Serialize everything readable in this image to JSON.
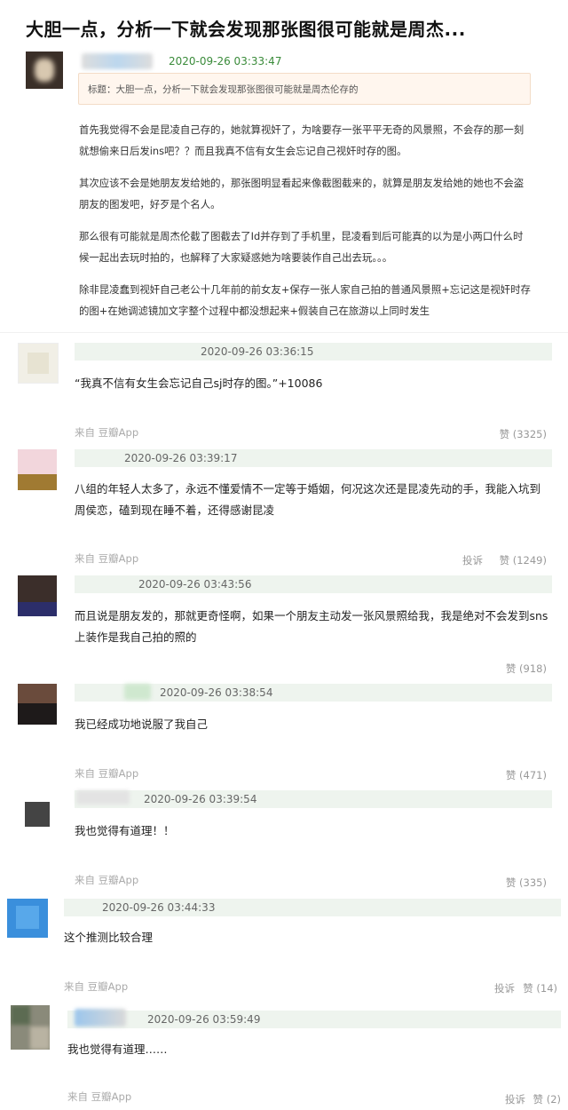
{
  "post": {
    "title": "大胆一点，分析一下就会发现那张图很可能就是周杰...",
    "timestamp": "2020-09-26 03:33:47",
    "quote": "标题：大胆一点，分析一下就会发现那张图很可能就是周杰伦存的",
    "paragraphs": [
      "首先我觉得不会是昆凌自己存的，她就算视奸了，为啥要存一张平平无奇的风景照，不会存的那一刻就想偷来日后发ins吧？？而且我真不信有女生会忘记自己视奸时存的图。",
      "其次应该不会是她朋友发给她的，那张图明显看起来像截图截来的，就算是朋友发给她的她也不会盗朋友的图发吧，好歹是个名人。",
      "那么很有可能就是周杰伦截了图截去了Id并存到了手机里，昆凌看到后可能真的以为是小两口什么时候一起出去玩时拍的，也解释了大家疑惑她为啥要装作自己出去玩。。。",
      "除非昆凌蠢到视奸自己老公十几年前的前女友+保存一张人家自己拍的普通风景照+忘记这是视奸时存的图+在她调滤镜加文字整个过程中都没想起来+假装自己在旅游以上同时发生"
    ]
  },
  "comments": [
    {
      "timestamp": "2020-09-26 03:36:15",
      "text": "“我真不信有女生会忘记自己sj时存的图。”+10086",
      "source": "来自 豆瓣App",
      "report": "",
      "likes": "赞 (3325)"
    },
    {
      "timestamp": "2020-09-26 03:39:17",
      "text": "八组的年轻人太多了，永远不懂爱情不一定等于婚姻，何况这次还是昆凌先动的手，我能入坑到周侯恋，磕到现在睡不着，还得感谢昆凌",
      "source": "来自 豆瓣App",
      "report": "投诉",
      "likes": "赞 (1249)"
    },
    {
      "timestamp": "2020-09-26 03:43:56",
      "text": "而且说是朋友发的，那就更奇怪啊，如果一个朋友主动发一张风景照给我，我是绝对不会发到sns上装作是我自己拍的照的",
      "source": "",
      "report": "",
      "likes": "赞 (918)"
    },
    {
      "timestamp": "2020-09-26 03:38:54",
      "text": "我已经成功地说服了我自己",
      "source": "来自 豆瓣App",
      "report": "",
      "likes": "赞 (471)"
    },
    {
      "timestamp": "2020-09-26 03:39:54",
      "text": "我也觉得有道理！！",
      "source": "来自 豆瓣App",
      "report": "",
      "likes": "赞 (335)"
    },
    {
      "timestamp": "2020-09-26 03:44:33",
      "text": "这个推测比较合理",
      "source": "来自 豆瓣App",
      "report": "投诉",
      "likes": "赞 (14)"
    },
    {
      "timestamp": "2020-09-26 03:59:49",
      "text": "我也觉得有道理……",
      "source": "来自 豆瓣App",
      "report": "投诉",
      "likes": "赞 (2)"
    }
  ],
  "colors": {
    "timestamp_green": "#3a8b3a",
    "meta_bar": "#eef4ee",
    "quote_bg": "#fff6ee"
  }
}
